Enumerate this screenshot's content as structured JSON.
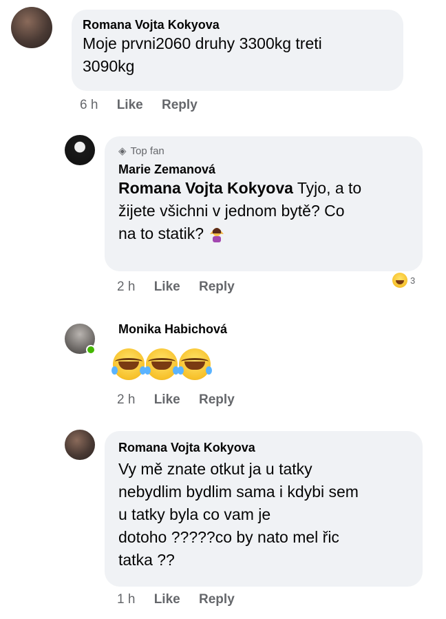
{
  "comments": [
    {
      "author": "Romana Vojta Kokyova",
      "text": "Moje prvni2060 druhy 3300kg treti 3090kg",
      "line1": "Moje prvni2060 druhy 3300kg treti",
      "line2": "3090kg",
      "time": "6 h",
      "like_label": "Like",
      "reply_label": "Reply"
    },
    {
      "badge": "Top fan",
      "author": "Marie Zemanová",
      "mention": "Romana Vojta Kokyova",
      "line1_rest": " Tyjo, a to",
      "line2": "žijete všichni v jednom bytě? Co",
      "line3": "na to statik?",
      "trailing_emoji": "woman-shrugging-emoji",
      "time": "2 h",
      "like_label": "Like",
      "reply_label": "Reply",
      "reaction_count": "3",
      "reaction_icon": "laughing-emoji"
    },
    {
      "author": "Monika Habichová",
      "emojis": [
        "joy-emoji",
        "joy-emoji",
        "joy-emoji"
      ],
      "time": "2 h",
      "like_label": "Like",
      "reply_label": "Reply"
    },
    {
      "author": "Romana Vojta Kokyova",
      "line1": "Vy mě znate otkut  ja u tatky",
      "line2": "nebydlim bydlim sama  i kdybi sem",
      "line3": "u tatky byla co vam je",
      "line4": "dotoho ?????co by nato mel řic",
      "line5": "tatka ??",
      "time": "1 h",
      "like_label": "Like",
      "reply_label": "Reply"
    }
  ],
  "colors": {
    "bubble": "#f0f2f5",
    "meta": "#65676b",
    "online": "#44b700"
  }
}
